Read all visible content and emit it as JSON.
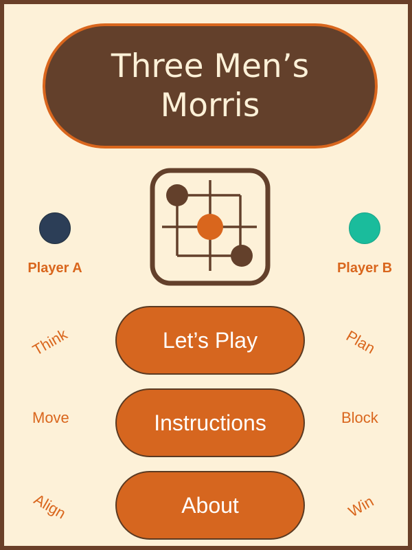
{
  "title": "Three Men’s\nMorris",
  "players": {
    "a": {
      "label": "Player A",
      "color": "#2c3e57"
    },
    "b": {
      "label": "Player B",
      "color": "#1abc9c"
    }
  },
  "menu": {
    "play": "Let’s Play",
    "instructions": "Instructions",
    "about": "About"
  },
  "decorations": {
    "left": [
      "Think",
      "Move",
      "Align"
    ],
    "right": [
      "Plan",
      "Block",
      "Win"
    ]
  },
  "colors": {
    "background": "#fdf1d8",
    "brown": "#63402b",
    "orange": "#d6661f",
    "border": "#6a4028"
  },
  "board_icon": "three-mens-morris-board-icon"
}
